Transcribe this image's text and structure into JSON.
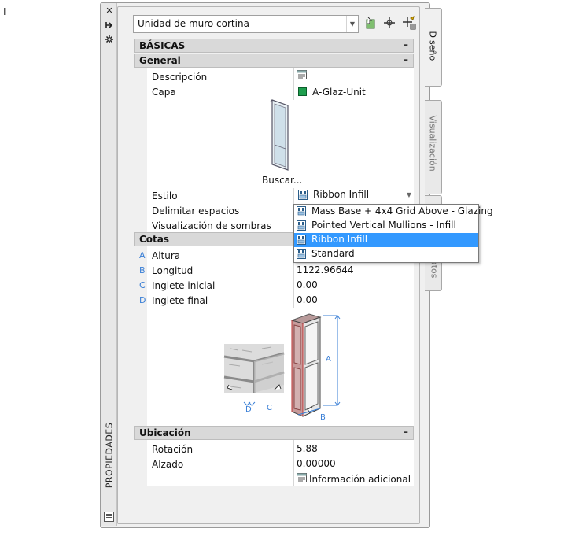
{
  "stray_mark": "I",
  "palette": {
    "title": "PROPIEDADES",
    "object_type": "Unidad de muro cortina",
    "tabs": [
      "Diseño",
      "Visualización",
      "Datos"
    ]
  },
  "sections": {
    "basicas": "BÁSICAS",
    "general": "General",
    "cotas": "Cotas",
    "ubicacion": "Ubicación"
  },
  "general": {
    "descripcion_label": "Descripción",
    "capa_label": "Capa",
    "capa_value": "A-Glaz-Unit",
    "capa_color": "#1e9e4e",
    "buscar_label": "Buscar...",
    "estilo_label": "Estilo",
    "estilo_value": "Ribbon Infill",
    "delimitar_label": "Delimitar espacios",
    "sombras_label": "Visualización de sombras"
  },
  "estilo_options": [
    "Mass Base + 4x4 Grid Above - Glazing",
    "Pointed Vertical Mullions - Infill",
    "Ribbon Infill",
    "Standard"
  ],
  "estilo_selected_index": 2,
  "cotas": {
    "altura_letter": "A",
    "altura_label": "Altura",
    "longitud_letter": "B",
    "longitud_label": "Longitud",
    "longitud_value": "1122.96644",
    "inglete_inicial_letter": "C",
    "inglete_inicial_label": "Inglete inicial",
    "inglete_inicial_value": "0.00",
    "inglete_final_letter": "D",
    "inglete_final_label": "Inglete final",
    "inglete_final_value": "0.00",
    "diagram_labels": [
      "A",
      "B",
      "C",
      "D"
    ]
  },
  "ubicacion": {
    "rotacion_label": "Rotación",
    "rotacion_value": "5.88",
    "alzado_label": "Alzado",
    "alzado_value": "0.00000",
    "info_label": "Información adicional"
  },
  "colors": {
    "selection": "#3399ff",
    "dimension_blue": "#3a7fd6"
  }
}
